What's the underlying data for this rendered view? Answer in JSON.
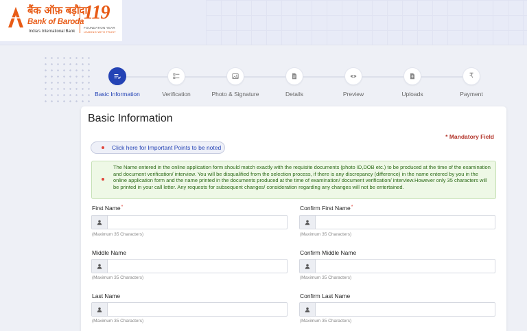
{
  "brand": {
    "hindi_name": "बैंक ऑफ़ बड़ौदा",
    "name": "Bank of Baroda",
    "tagline": "India's International Bank",
    "anniversary_number": "119",
    "anniversary_line1": "FOUNDATION YEAR",
    "anniversary_line2": "LEADING WITH TRUST",
    "accent_color": "#e85b16"
  },
  "stepper": {
    "active_color": "#2443b5",
    "steps": [
      {
        "label": "Basic Information",
        "icon": "list-check-icon",
        "active": true
      },
      {
        "label": "Verification",
        "icon": "checklist-icon",
        "active": false
      },
      {
        "label": "Photo & Signature",
        "icon": "image-icon",
        "active": false
      },
      {
        "label": "Details",
        "icon": "document-icon",
        "active": false
      },
      {
        "label": "Preview",
        "icon": "eye-icon",
        "active": false
      },
      {
        "label": "Uploads",
        "icon": "upload-file-icon",
        "active": false
      },
      {
        "label": "Payment",
        "icon": "rupee-icon",
        "active": false
      }
    ]
  },
  "form": {
    "title": "Basic Information",
    "mandatory_note": "* Mandatory Field",
    "important_points_label": "Click here for Important Points to be noted",
    "notice": "The Name entered in the online application form should match exactly with the requisite documents (photo ID,DOB etc.) to be produced at the time of the examination and document verification/ interview. You will be disqualified from the selection process, if there is any discrepancy (difference) in the name entered by you in the online application form and the name printed in the documents produced at the time of examination/ document verification/ interview.However only 35 characters will be printed in your call letter. Any requests for subsequent changes/ consideration regarding any changes will not be entertained.",
    "fields": {
      "first_name": {
        "label": "First Name",
        "required_mark": "*",
        "value": "",
        "hint": "(Maximum 35 Characters)"
      },
      "confirm_first_name": {
        "label": "Confirm First Name",
        "required_mark": "*",
        "value": "",
        "hint": "(Maximum 35 Characters)"
      },
      "middle_name": {
        "label": "Middle Name",
        "value": "",
        "hint": "(Maximum 35 Characters)"
      },
      "confirm_middle_name": {
        "label": "Confirm Middle Name",
        "value": "",
        "hint": "(Maximum 35 Characters)"
      },
      "last_name": {
        "label": "Last Name",
        "value": "",
        "hint": "(Maximum 35 Characters)"
      },
      "confirm_last_name": {
        "label": "Confirm Last Name",
        "value": "",
        "hint": "(Maximum 35 Characters)"
      }
    }
  }
}
